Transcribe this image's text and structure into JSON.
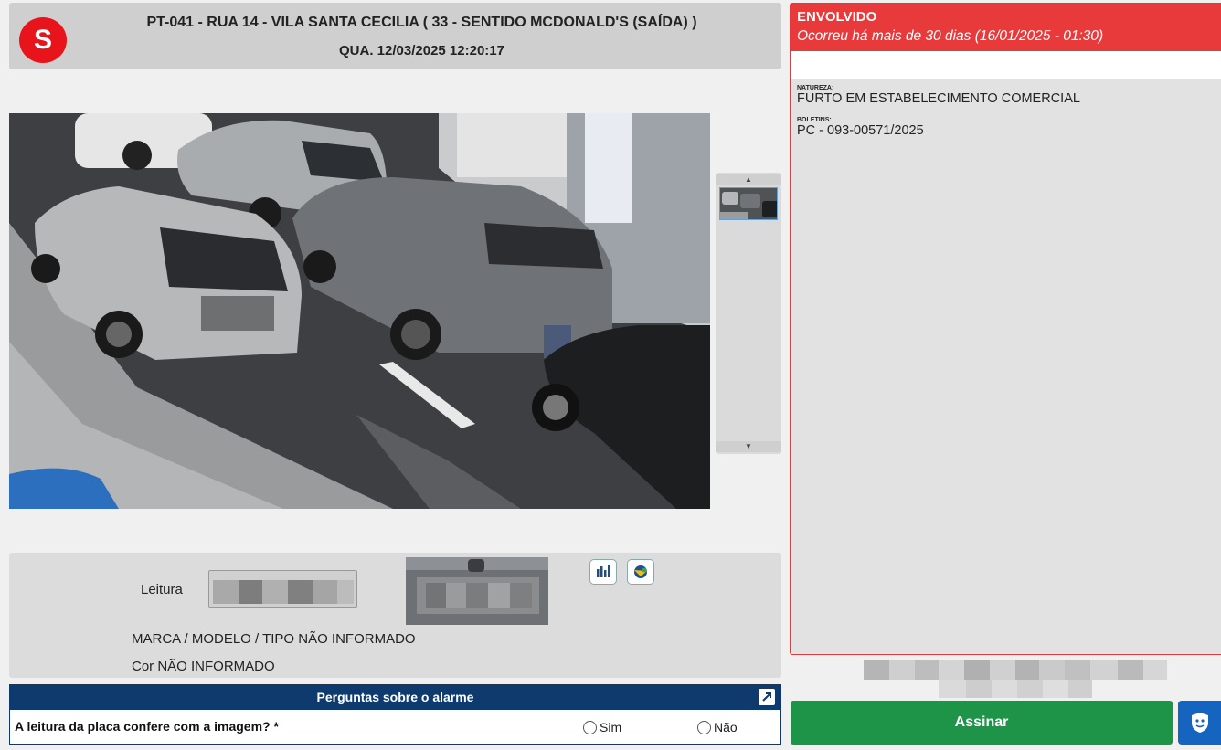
{
  "header": {
    "logo_letter": "S",
    "title": "PT-041 - RUA 14  - VILA SANTA CECILIA ( 33 - SENTIDO MCDONALD'S (SAÍDA) )",
    "datetime": "QUA. 12/03/2025 12:20:17"
  },
  "reading": {
    "leitura_label": "Leitura",
    "marca_modelo": "MARCA / MODELO / TIPO NÃO INFORMADO",
    "cor": "Cor NÃO INFORMADO"
  },
  "questions": {
    "header": "Perguntas sobre o alarme",
    "question": "A leitura da placa confere com a imagem? *",
    "option_yes": "Sim",
    "option_no": "Não"
  },
  "envolvido": {
    "title": "ENVOLVIDO",
    "subtitle": "Ocorreu há mais de 30 dias (16/01/2025 - 01:30)",
    "natureza_label": "NATUREZA:",
    "natureza_value": "FURTO EM ESTABELECIMENTO COMERCIAL",
    "boletins_label": "BOLETINS:",
    "boletins_value": "PC - 093-00571/2025"
  },
  "actions": {
    "sign_label": "Assinar"
  },
  "colors": {
    "alert_red": "#e8393b",
    "nav_blue": "#0f3a6e",
    "sign_green": "#1e9449",
    "logo_red": "#e8141b"
  },
  "icons": [
    "chart-icon",
    "map-icon",
    "expand-icon",
    "shield-icon"
  ]
}
